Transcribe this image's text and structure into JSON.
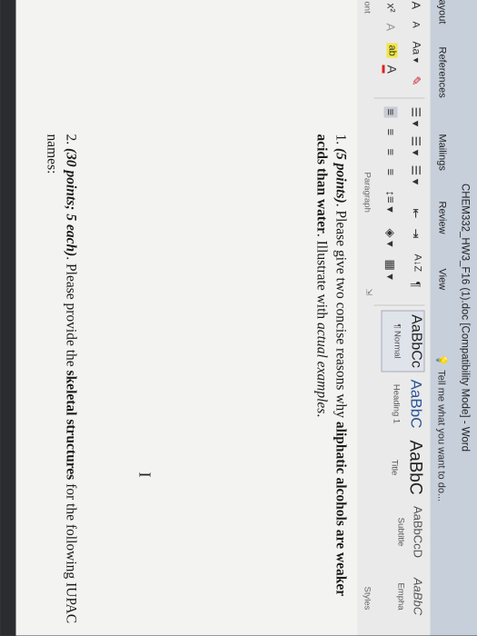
{
  "window": {
    "title": "CHEM332_HW3_F16 (1).doc [Compatibility Mode] - Word"
  },
  "tabs": [
    "ayout",
    "References",
    "Mailings",
    "Review",
    "View"
  ],
  "tell_me": "Tell me what you want to do...",
  "ribbon": {
    "font_row1": [
      "A",
      "A",
      "Aa",
      "▾"
    ],
    "font_row2": [
      "x²",
      "A",
      "ab",
      "A"
    ],
    "font_group": "ont",
    "paragraph_group": "Paragraph",
    "styles_group": "Styles",
    "styles": [
      {
        "sample": "AaBbCc",
        "name": "¶ Normal"
      },
      {
        "sample": "AaBbC",
        "name": "Heading 1"
      },
      {
        "sample": "AaBbC",
        "name": "Title"
      },
      {
        "sample": "AaBbCcD",
        "name": "Subtitle"
      },
      {
        "sample": "AaBbC",
        "name": "Empha"
      }
    ]
  },
  "document": {
    "q1_prefix": "1. ",
    "q1_points": "(5 points)",
    "q1_text_a": ". Please give two concise reasons why ",
    "q1_bold": "aliphatic alcohols are weaker acids than water",
    "q1_text_b": ". Illustrate with ",
    "q1_italic": "actual examples",
    "q1_end": ".",
    "q2_prefix": "2. ",
    "q2_points": "(30 points; 5 each)",
    "q2_text_a": ". Please provide the ",
    "q2_bold": "skeletal structures",
    "q2_text_b": " for the following IUPAC names:",
    "cursor": "I"
  }
}
